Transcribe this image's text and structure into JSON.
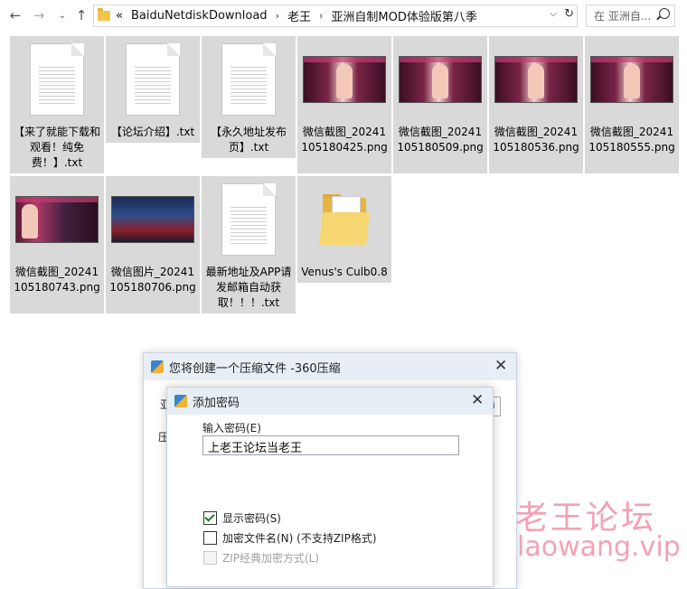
{
  "explorer": {
    "nav": {
      "back": "←",
      "forward": "→",
      "up": "↑",
      "history": "⌄"
    },
    "breadcrumb": {
      "overflow": "«",
      "items": [
        "BaiduNetdiskDownload",
        "老王",
        "亚洲自制MOD体验版第八季"
      ],
      "separator": "›"
    },
    "search_placeholder": "在 亚洲自...",
    "files": [
      {
        "name": "【来了就能下载和观看！纯免费！】.txt",
        "kind": "txt"
      },
      {
        "name": "【论坛介绍】.txt",
        "kind": "txt"
      },
      {
        "name": "【永久地址发布页】.txt",
        "kind": "txt"
      },
      {
        "name": "微信截图_20241105180425.png",
        "kind": "png"
      },
      {
        "name": "微信截图_20241105180509.png",
        "kind": "png"
      },
      {
        "name": "微信截图_20241105180536.png",
        "kind": "png"
      },
      {
        "name": "微信截图_20241105180555.png",
        "kind": "png"
      },
      {
        "name": "微信截图_20241105180743.png",
        "kind": "png"
      },
      {
        "name": "微信图片_20241105180706.png",
        "kind": "png"
      },
      {
        "name": "最新地址及APP请发邮箱自动获取！！！.txt",
        "kind": "txt"
      },
      {
        "name": "Venus's Culb0.8",
        "kind": "folder"
      }
    ]
  },
  "compress_dialog": {
    "title": "您将创建一个压缩文件 -360压缩",
    "field_label_fragment": "亚",
    "label_fragment": "压"
  },
  "password_dialog": {
    "title": "添加密码",
    "password_label": "输入密码(E)",
    "password_value": "上老王论坛当老王",
    "options": [
      {
        "label": "显示密码(S)",
        "checked": true,
        "enabled": true
      },
      {
        "label": "加密文件名(N) (不支持ZIP格式)",
        "checked": false,
        "enabled": true
      },
      {
        "label": "ZIP经典加密方式(L)",
        "checked": false,
        "enabled": false
      }
    ]
  },
  "watermark": {
    "line1": "老王论坛",
    "line2": "laowang.vip"
  }
}
